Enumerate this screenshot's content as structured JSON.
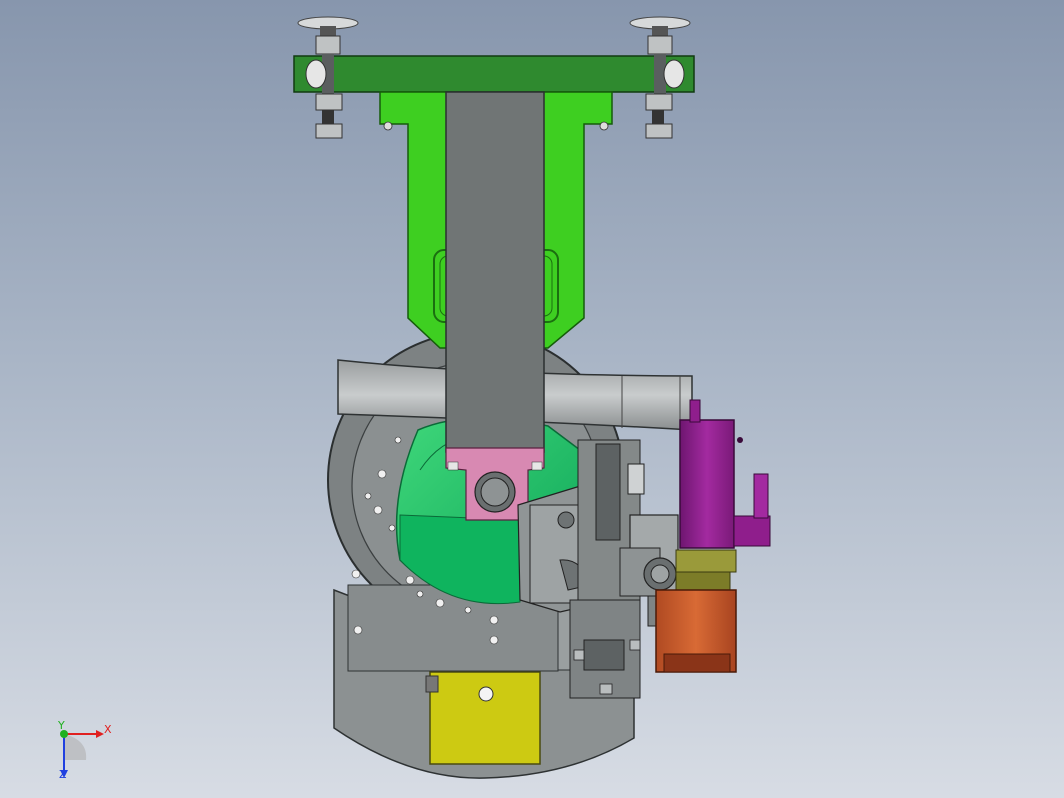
{
  "triad": {
    "x_label": "X",
    "y_label": "Y",
    "z_label": "Z",
    "x_color": "#e02020",
    "y_color": "#20b020",
    "z_color": "#2040e0"
  },
  "palette": {
    "background_top": "#8796ad",
    "background_bottom": "#d7dce4",
    "mount_bar": "#2f8a2f",
    "mount_bracket": "#3ecf21",
    "arm": "#6f7474",
    "disk": "#13c468",
    "pink_block": "#d889b2",
    "purple_motor": "#8f1e8c",
    "orange_motor": "#c25a2b",
    "yellow_plate": "#cbc80f",
    "base_gray": "#8e9394"
  }
}
